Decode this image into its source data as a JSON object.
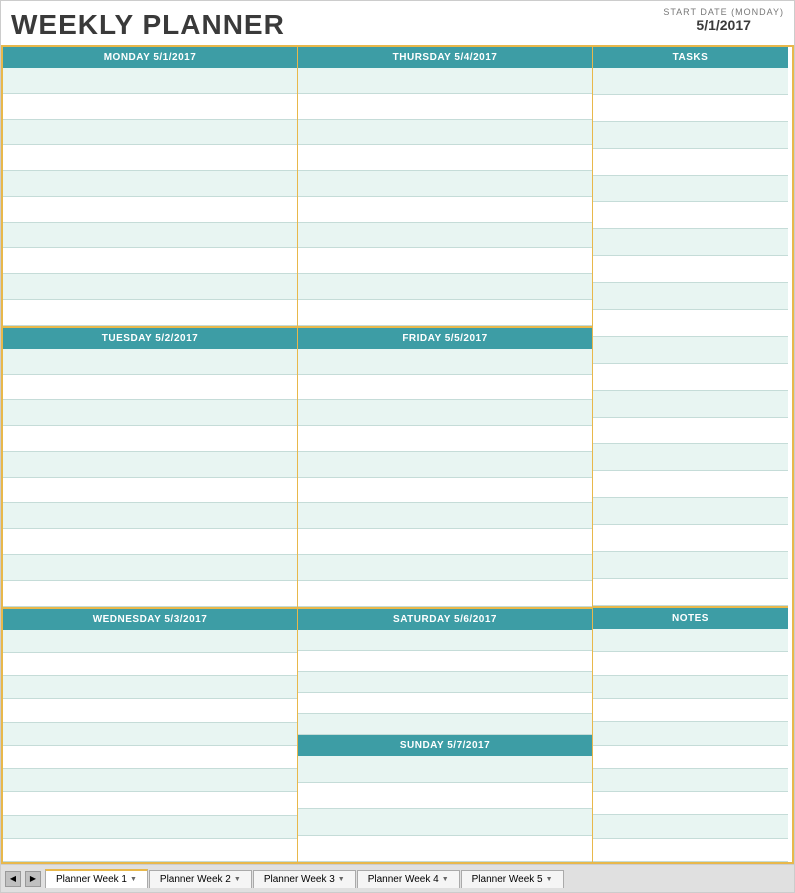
{
  "header": {
    "title": "WEEKLY PLANNER",
    "start_date_label": "START DATE (MONDAY)",
    "start_date_value": "5/1/2017"
  },
  "days": {
    "monday": {
      "label": "MONDAY 5/1/2017",
      "rows": 10
    },
    "tuesday": {
      "label": "TUESDAY 5/2/2017",
      "rows": 10
    },
    "wednesday": {
      "label": "WEDNESDAY 5/3/2017",
      "rows": 10
    },
    "thursday": {
      "label": "THURSDAY 5/4/2017",
      "rows": 10
    },
    "friday": {
      "label": "FRIDAY 5/5/2017",
      "rows": 10
    },
    "saturday": {
      "label": "SATURDAY 5/6/2017",
      "rows": 5
    },
    "sunday": {
      "label": "SUNDAY 5/7/2017",
      "rows": 4
    }
  },
  "tasks": {
    "label": "TASKS",
    "rows": 20
  },
  "notes": {
    "label": "NOTES",
    "rows": 10
  },
  "tabs": [
    {
      "label": "Planner Week 1",
      "active": true
    },
    {
      "label": "Planner Week 2",
      "active": false
    },
    {
      "label": "Planner Week 3",
      "active": false
    },
    {
      "label": "Planner Week 4",
      "active": false
    },
    {
      "label": "Planner Week 5",
      "active": false
    }
  ],
  "colors": {
    "header_bg": "#3d9da5",
    "header_text": "#ffffff",
    "row_alt": "#e8f5f2",
    "row_plain": "#ffffff",
    "border_accent": "#e8b84b",
    "row_border": "#c5dcd8"
  }
}
